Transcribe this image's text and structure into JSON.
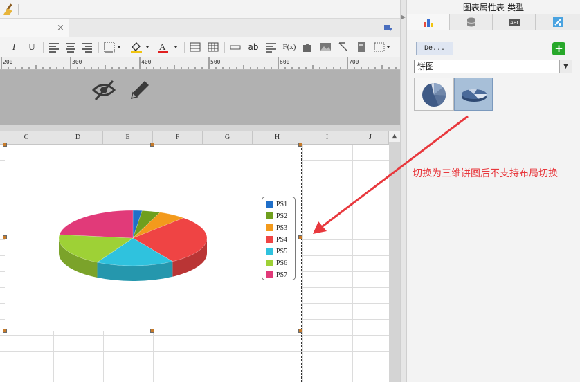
{
  "app": {
    "app_icon": "broom-icon",
    "tab_close": "×"
  },
  "toolbar": {
    "items": [
      "italic-icon",
      "underline-icon",
      "align-left-icon",
      "align-center-icon",
      "align-right-icon",
      "borders-icon",
      "fill-color-icon",
      "font-color-icon",
      "merge-icon",
      "table-icon",
      "field-icon",
      "text-icon",
      "paragraph-icon",
      "formula-icon",
      "puzzle-icon",
      "image-icon",
      "line-icon",
      "document-icon",
      "frame-icon"
    ],
    "ab_label": "ab",
    "fx_label": "F(x)"
  },
  "ruler": {
    "labels": [
      "200",
      "300",
      "400",
      "500",
      "600",
      "700"
    ]
  },
  "sheet": {
    "columns": [
      "C",
      "D",
      "E",
      "F",
      "G",
      "H",
      "I",
      "J"
    ]
  },
  "chart_data": {
    "type": "pie",
    "style": "3d",
    "series": [
      {
        "name": "PS1",
        "value": 2,
        "color": "#1f6fc9"
      },
      {
        "name": "PS2",
        "value": 4,
        "color": "#6f9f1e"
      },
      {
        "name": "PS3",
        "value": 6,
        "color": "#f39a1c"
      },
      {
        "name": "PS4",
        "value": 29,
        "color": "#ef4444"
      },
      {
        "name": "PS5",
        "value": 17,
        "color": "#2fc2de"
      },
      {
        "name": "PS6",
        "value": 19,
        "color": "#9ed136"
      },
      {
        "name": "PS7",
        "value": 23,
        "color": "#e13a79"
      }
    ],
    "legend_position": "right"
  },
  "right_panel": {
    "title": "图表属性表-类型",
    "tabs": [
      "chart-type-icon",
      "database-icon",
      "text-style-icon",
      "effects-icon"
    ],
    "data_button": "De...",
    "add_icon": "+",
    "type_value": "饼图",
    "thumbs": [
      "pie-2d-thumb",
      "pie-3d-thumb"
    ]
  },
  "annotation": {
    "text": "切换为三维饼图后不支持布局切换",
    "color": "#e8383d"
  }
}
